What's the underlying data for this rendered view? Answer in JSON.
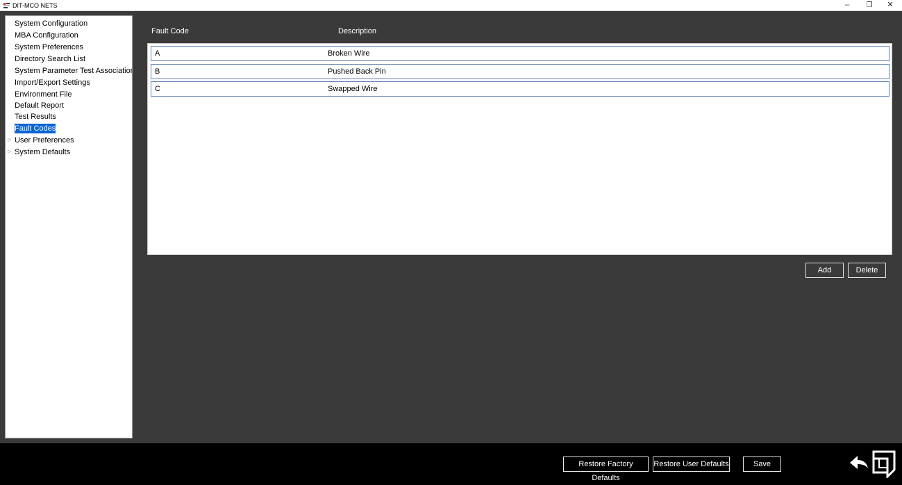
{
  "window": {
    "title": "DIT-MCO NETS",
    "minimize_glyph": "–",
    "restore_glyph": "❐",
    "close_glyph": "✕"
  },
  "tree": {
    "items": [
      {
        "label": "System Configuration",
        "selected": false,
        "expandable": false
      },
      {
        "label": "MBA Configuration",
        "selected": false,
        "expandable": false
      },
      {
        "label": "System Preferences",
        "selected": false,
        "expandable": false
      },
      {
        "label": "Directory Search List",
        "selected": false,
        "expandable": false
      },
      {
        "label": "System Parameter Test Associations",
        "selected": false,
        "expandable": false
      },
      {
        "label": "Import/Export Settings",
        "selected": false,
        "expandable": false
      },
      {
        "label": "Environment File",
        "selected": false,
        "expandable": false
      },
      {
        "label": "Default Report",
        "selected": false,
        "expandable": false
      },
      {
        "label": "Test Results",
        "selected": false,
        "expandable": false
      },
      {
        "label": "Fault Codes",
        "selected": true,
        "expandable": false
      },
      {
        "label": "User Preferences",
        "selected": false,
        "expandable": true
      },
      {
        "label": "System Defaults",
        "selected": false,
        "expandable": true
      }
    ],
    "expander_glyph": "▷"
  },
  "grid": {
    "headers": {
      "code": "Fault Code",
      "description": "Description"
    },
    "rows": [
      {
        "code": "A",
        "description": "Broken Wire"
      },
      {
        "code": "B",
        "description": "Pushed Back Pin"
      },
      {
        "code": "C",
        "description": "Swapped Wire"
      }
    ]
  },
  "actions": {
    "add_label": "Add",
    "delete_label": "Delete"
  },
  "footer": {
    "restore_factory_label": "Restore Factory Defaults",
    "restore_user_label": "Restore User Defaults",
    "save_label": "Save"
  },
  "icons": {
    "back": "back-arrow-icon",
    "exit": "exit-door-icon",
    "app": "app-logo-icon"
  },
  "colors": {
    "selection": "#0a64d8",
    "background": "#3a3a3a",
    "footer": "#000000",
    "row_border": "#5d7fb8"
  }
}
